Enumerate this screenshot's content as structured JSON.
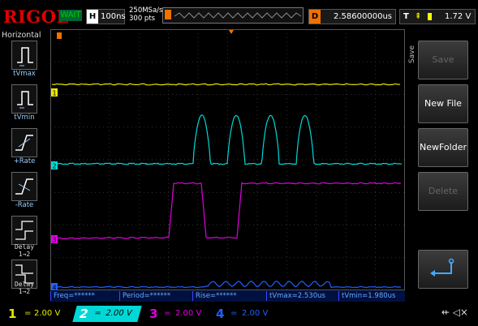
{
  "header": {
    "logo": "RIGOL",
    "status": "WAIT",
    "h_label": "H",
    "h_value": "100ns",
    "rate_line1": "250MSa/s",
    "rate_line2": "300 pts",
    "d_label": "D",
    "d_value": "2.58600000us",
    "t_label": "T",
    "t_value": "1.72 V"
  },
  "left_panel": {
    "title": "Horizontal",
    "buttons": [
      {
        "label": "tVmax",
        "icon": "tvmax-icon"
      },
      {
        "label": "tVmin",
        "icon": "tvmin-icon"
      },
      {
        "label": "+Rate",
        "icon": "rise-rate-icon"
      },
      {
        "label": "-Rate",
        "icon": "fall-rate-icon"
      },
      {
        "label": "Delay\n1→2",
        "icon": "delay-rise-icon"
      },
      {
        "label": "Delay\n1→2",
        "icon": "delay-fall-icon"
      }
    ]
  },
  "right_menu": {
    "title": "Save",
    "items": [
      {
        "label": "Save",
        "enabled": false
      },
      {
        "label": "New File",
        "enabled": true
      },
      {
        "label": "NewFolder",
        "enabled": true
      },
      {
        "label": "Delete",
        "enabled": false
      }
    ],
    "return_icon": "return-icon"
  },
  "channels": {
    "1": {
      "marker": "1",
      "color": "#e8e800"
    },
    "2": {
      "marker": "2",
      "color": "#00d8d8"
    },
    "3": {
      "marker": "3",
      "color": "#e000e0"
    },
    "4": {
      "marker": "4",
      "color": "#2060ff"
    }
  },
  "measurements": {
    "freq": "Freq=******",
    "period": "Period=******",
    "rise": "Rise=******",
    "tvmax": "tVmax=2.530us",
    "tvmin": "tVmin=1.980us"
  },
  "bottom_bar": [
    {
      "num": "1",
      "scale": "2.00 V",
      "color": "#e8e800"
    },
    {
      "num": "2",
      "scale": "2.00 V",
      "color": "#00d8d8"
    },
    {
      "num": "3",
      "scale": "2.00 V",
      "color": "#e000e0"
    },
    {
      "num": "4",
      "scale": "2.00 V",
      "color": "#2060ff"
    }
  ],
  "status_icons": [
    "usb-icon",
    "speaker-muted-icon"
  ]
}
